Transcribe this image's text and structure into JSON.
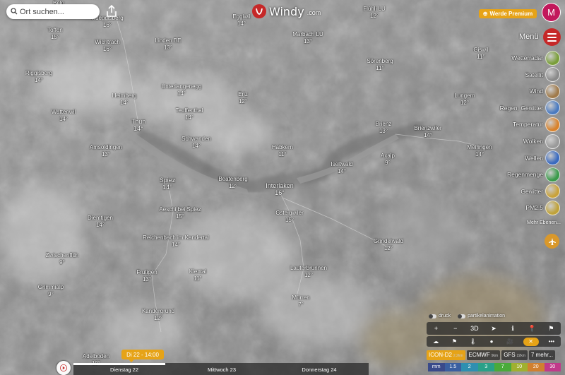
{
  "app": {
    "logo_text": "Windy",
    "logo_domain": ".com"
  },
  "search": {
    "placeholder": "Ort suchen..."
  },
  "header": {
    "premium_label": "Werde Premium",
    "avatar_letter": "M"
  },
  "menu": {
    "label": "Menü"
  },
  "layers": [
    {
      "label": "Wetterradar",
      "icon": "radar-icon",
      "color": "#7a9e3a"
    },
    {
      "label": "Satellit",
      "icon": "satellite-icon",
      "color": "#8a8a8a"
    },
    {
      "label": "Wind",
      "icon": "wind-icon",
      "color": "#a07a4a"
    },
    {
      "label": "Regen, Gewitter",
      "icon": "rain-icon",
      "color": "#4a7ac0"
    },
    {
      "label": "Temperatur",
      "icon": "temperature-icon",
      "color": "#d9822b"
    },
    {
      "label": "Wolken",
      "icon": "clouds-icon",
      "color": "#9a9a9a"
    },
    {
      "label": "Wellen",
      "icon": "waves-icon",
      "color": "#3a6abf"
    },
    {
      "label": "Regenmenge",
      "icon": "rain-accumulation-icon",
      "color": "#3a9a4a"
    },
    {
      "label": "Gewitter",
      "icon": "thunder-icon",
      "color": "#c9a23a"
    },
    {
      "label": "PM2.5",
      "icon": "pm25-icon",
      "color": "#bfa23a"
    }
  ],
  "more_layers_label": "Mehr Ebenen...",
  "places": [
    {
      "name": "Belp",
      "temp": ""
    },
    {
      "name": "Toffen",
      "temp": "15°"
    },
    {
      "name": "Rüeggisberg",
      "temp": "16°"
    },
    {
      "name": "Wichtrach",
      "temp": "16°"
    },
    {
      "name": "Riggisberg",
      "temp": "14°"
    },
    {
      "name": "Heimberg",
      "temp": "14°"
    },
    {
      "name": "Wattenwil",
      "temp": "14°"
    },
    {
      "name": "Thun",
      "temp": "14°"
    },
    {
      "name": "Amsoldingen",
      "temp": "13°"
    },
    {
      "name": "Spiez",
      "temp": "14°"
    },
    {
      "name": "Blumenstein",
      "temp": ""
    },
    {
      "name": "Linden BE",
      "temp": "13°"
    },
    {
      "name": "Eggiwil",
      "temp": "14°"
    },
    {
      "name": "Unterlangenegg",
      "temp": "14°"
    },
    {
      "name": "Teuffenthal",
      "temp": "14°"
    },
    {
      "name": "Schwanden",
      "temp": "14°"
    },
    {
      "name": "Beatenberg",
      "temp": "12°"
    },
    {
      "name": "Habkern",
      "temp": "11°"
    },
    {
      "name": "Interlaken",
      "temp": "16°"
    },
    {
      "name": "Aeschi bei Spiez",
      "temp": "15°"
    },
    {
      "name": "Gsteigwiler",
      "temp": "15°"
    },
    {
      "name": "Reichenbach im Kandertal",
      "temp": "14°"
    },
    {
      "name": "Frutigen",
      "temp": "13°"
    },
    {
      "name": "Kiental",
      "temp": "11°"
    },
    {
      "name": "Kandergrund",
      "temp": "12°"
    },
    {
      "name": "Adelboden",
      "temp": "10°"
    },
    {
      "name": "Erlenbach",
      "temp": ""
    },
    {
      "name": "Diemtigen",
      "temp": "14°"
    },
    {
      "name": "Därstetten",
      "temp": ""
    },
    {
      "name": "Zwischenflüh",
      "temp": "9°"
    },
    {
      "name": "Grimmialp",
      "temp": "9°"
    },
    {
      "name": "Marbach LU",
      "temp": "13°"
    },
    {
      "name": "Schangnau",
      "temp": ""
    },
    {
      "name": "Flühli LU",
      "temp": "12°"
    },
    {
      "name": "Sörenberg",
      "temp": "11°"
    },
    {
      "name": "Eriz",
      "temp": "12°"
    },
    {
      "name": "Giswil",
      "temp": "11°"
    },
    {
      "name": "Melchtal",
      "temp": ""
    },
    {
      "name": "Lungern",
      "temp": "12°"
    },
    {
      "name": "Brienz",
      "temp": "13°"
    },
    {
      "name": "Brienzwiler",
      "temp": "14°"
    },
    {
      "name": "Meiringen",
      "temp": "14°"
    },
    {
      "name": "Iseltwald",
      "temp": "14°"
    },
    {
      "name": "Axalp",
      "temp": "9°"
    },
    {
      "name": "Lauterbrunnen",
      "temp": "12°"
    },
    {
      "name": "Mürren",
      "temp": "7°"
    },
    {
      "name": "Grindelwald",
      "temp": "12°"
    },
    {
      "name": "Gadmen",
      "temp": "10°"
    },
    {
      "name": "Guttannen",
      "temp": "11°"
    },
    {
      "name": "Zweisimmen",
      "temp": ""
    },
    {
      "name": "Lenk",
      "temp": ""
    },
    {
      "name": "Kiensteg",
      "temp": "8°"
    },
    {
      "name": "Stephan",
      "temp": ""
    },
    {
      "name": "Oberwil",
      "temp": ""
    }
  ],
  "toggles": [
    {
      "label": "druck"
    },
    {
      "label": "partikelanimation"
    }
  ],
  "tools_row1": [
    "+",
    "−",
    "3D",
    "➤",
    "ℹ",
    "📍",
    "⚑"
  ],
  "tools_row2": {
    "items": [
      "☁",
      "⚑",
      "🌡",
      "●",
      "🎥"
    ],
    "close": "✕",
    "more": "•••"
  },
  "models": [
    {
      "name": "ICON-D2",
      "res": "2.2km",
      "active": true
    },
    {
      "name": "ECMWF",
      "res": "9km",
      "active": false
    },
    {
      "name": "GFS",
      "res": "22km",
      "active": false
    },
    {
      "name": "7 mehr...",
      "res": "",
      "active": false
    }
  ],
  "legend": {
    "unit": "mm",
    "steps": [
      {
        "label": "1.5",
        "color": "#3a5fa0"
      },
      {
        "label": "2",
        "color": "#2e8fb0"
      },
      {
        "label": "3",
        "color": "#2aa088"
      },
      {
        "label": "7",
        "color": "#4aaa3a"
      },
      {
        "label": "10",
        "color": "#a0b030"
      },
      {
        "label": "20",
        "color": "#d08030"
      },
      {
        "label": "30",
        "color": "#c03a8a"
      }
    ]
  },
  "timeline": {
    "current": "Di 22 - 14:00",
    "days": [
      "Dienstag 22",
      "Mittwoch 23",
      "Donnerstag 24"
    ],
    "progress": 0.31
  },
  "colors": {
    "accent": "#e6a317",
    "brand": "#c62828"
  }
}
